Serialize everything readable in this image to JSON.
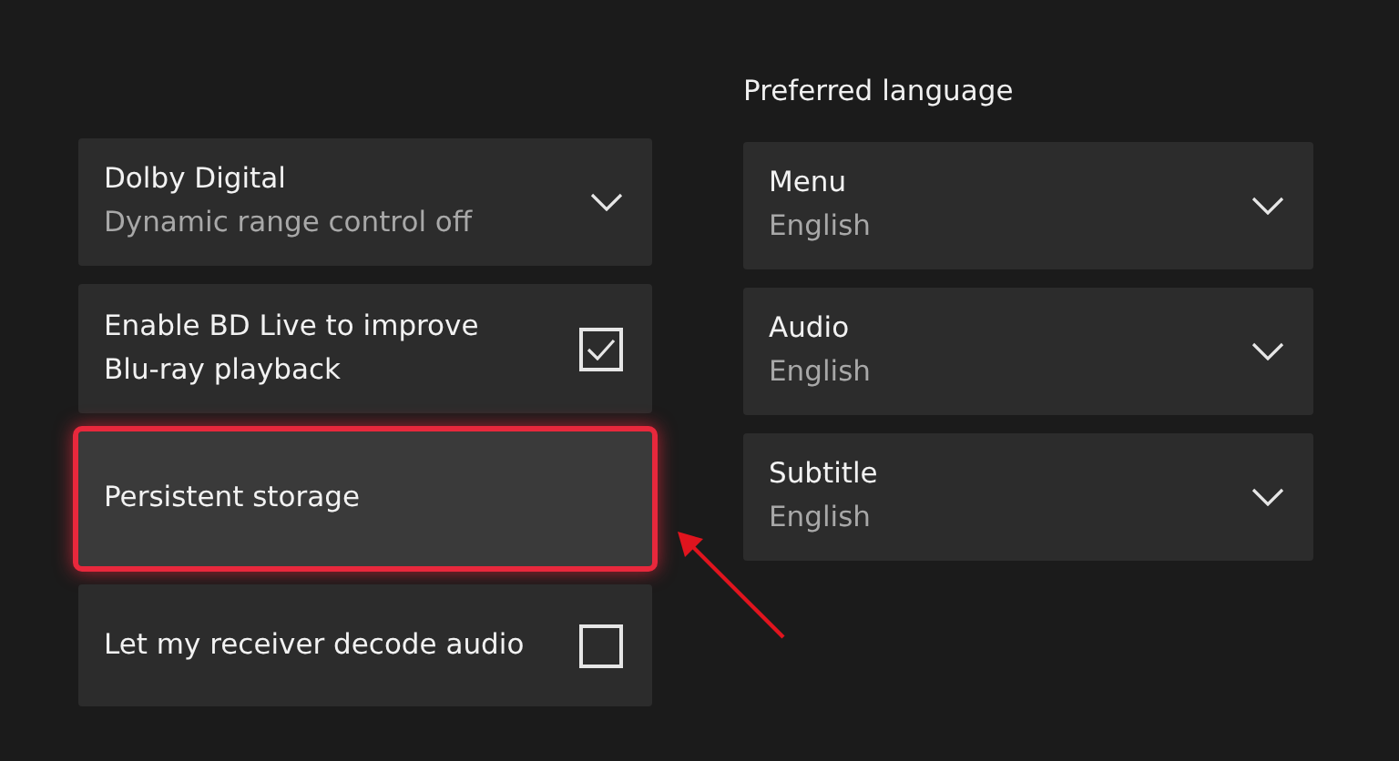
{
  "left_settings": [
    {
      "kind": "dropdown",
      "label": "Dolby Digital",
      "value": "Dynamic range control off",
      "highlighted": false
    },
    {
      "kind": "checkbox",
      "label": "Enable BD Live to improve Blu-ray playback",
      "checked": true,
      "highlighted": false
    },
    {
      "kind": "button",
      "label": "Persistent storage",
      "highlighted": true
    },
    {
      "kind": "checkbox",
      "label": "Let my receiver decode audio",
      "checked": false,
      "highlighted": false
    }
  ],
  "preferred_language": {
    "heading": "Preferred language",
    "items": [
      {
        "label": "Menu",
        "value": "English"
      },
      {
        "label": "Audio",
        "value": "English"
      },
      {
        "label": "Subtitle",
        "value": "English"
      }
    ]
  }
}
